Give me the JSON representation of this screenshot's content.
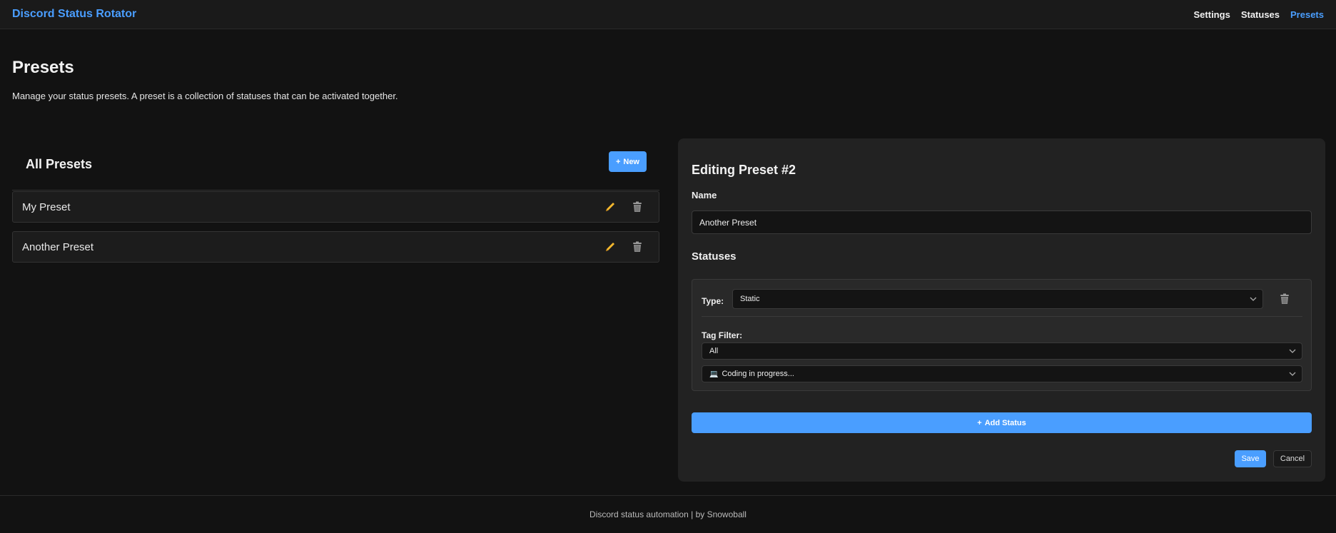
{
  "header": {
    "brand": "Discord Status Rotator",
    "nav": [
      {
        "label": "Settings",
        "active": false
      },
      {
        "label": "Statuses",
        "active": false
      },
      {
        "label": "Presets",
        "active": true
      }
    ]
  },
  "page": {
    "title": "Presets",
    "description": "Manage your status presets. A preset is a collection of statuses that can be activated together."
  },
  "presets_list": {
    "title": "All Presets",
    "new_button": "New",
    "items": [
      {
        "name": "My Preset"
      },
      {
        "name": "Another Preset"
      }
    ]
  },
  "editor": {
    "title": "Editing Preset #2",
    "name_label": "Name",
    "name_value": "Another Preset",
    "statuses_label": "Statuses",
    "status": {
      "type_label": "Type:",
      "type_value": "Static",
      "tag_filter_label": "Tag Filter:",
      "tag_filter_value": "All",
      "status_icon": "💻",
      "status_value": "Coding in progress..."
    },
    "add_status_button": "Add Status",
    "save_button": "Save",
    "cancel_button": "Cancel"
  },
  "footer": {
    "text": "Discord status automation | by Snowoball"
  },
  "colors": {
    "accent": "#4a9eff",
    "background": "#121212",
    "panel": "#222222",
    "edit_icon": "#f5b82e"
  }
}
